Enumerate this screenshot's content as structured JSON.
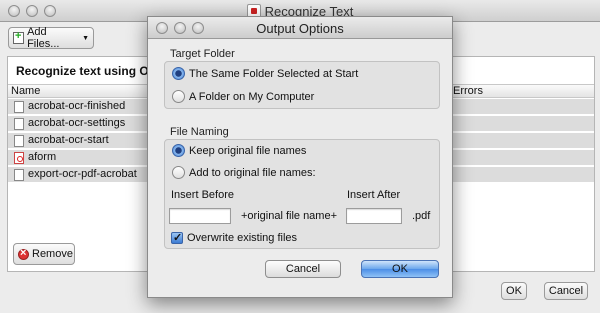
{
  "window": {
    "title": "Recognize Text",
    "add_files_label": "Add Files...",
    "panel_heading": "Recognize text using O",
    "columns": {
      "name": "Name",
      "errors": "Errors"
    },
    "files": [
      {
        "name": "acrobat-ocr-finished",
        "type": "doc"
      },
      {
        "name": "acrobat-ocr-settings",
        "type": "doc"
      },
      {
        "name": "acrobat-ocr-start",
        "type": "doc"
      },
      {
        "name": "aform",
        "type": "pdf"
      },
      {
        "name": "export-ocr-pdf-acrobat",
        "type": "doc"
      }
    ],
    "remove_label": "Remove",
    "ok_label": "OK",
    "cancel_label": "Cancel"
  },
  "dialog": {
    "title": "Output Options",
    "target_folder": {
      "label": "Target Folder",
      "options": [
        "The Same Folder Selected at Start",
        "A Folder on My Computer"
      ],
      "selected": 0
    },
    "file_naming": {
      "label": "File Naming",
      "options": [
        "Keep original file names",
        "Add to original file names:"
      ],
      "selected": 0,
      "insert_before_label": "Insert Before",
      "insert_after_label": "Insert After",
      "insert_before_value": "",
      "insert_after_value": "",
      "middle_text": "+original file name+",
      "extension": ".pdf",
      "overwrite_label": "Overwrite existing files",
      "overwrite_checked": true
    },
    "cancel_label": "Cancel",
    "ok_label": "OK"
  }
}
